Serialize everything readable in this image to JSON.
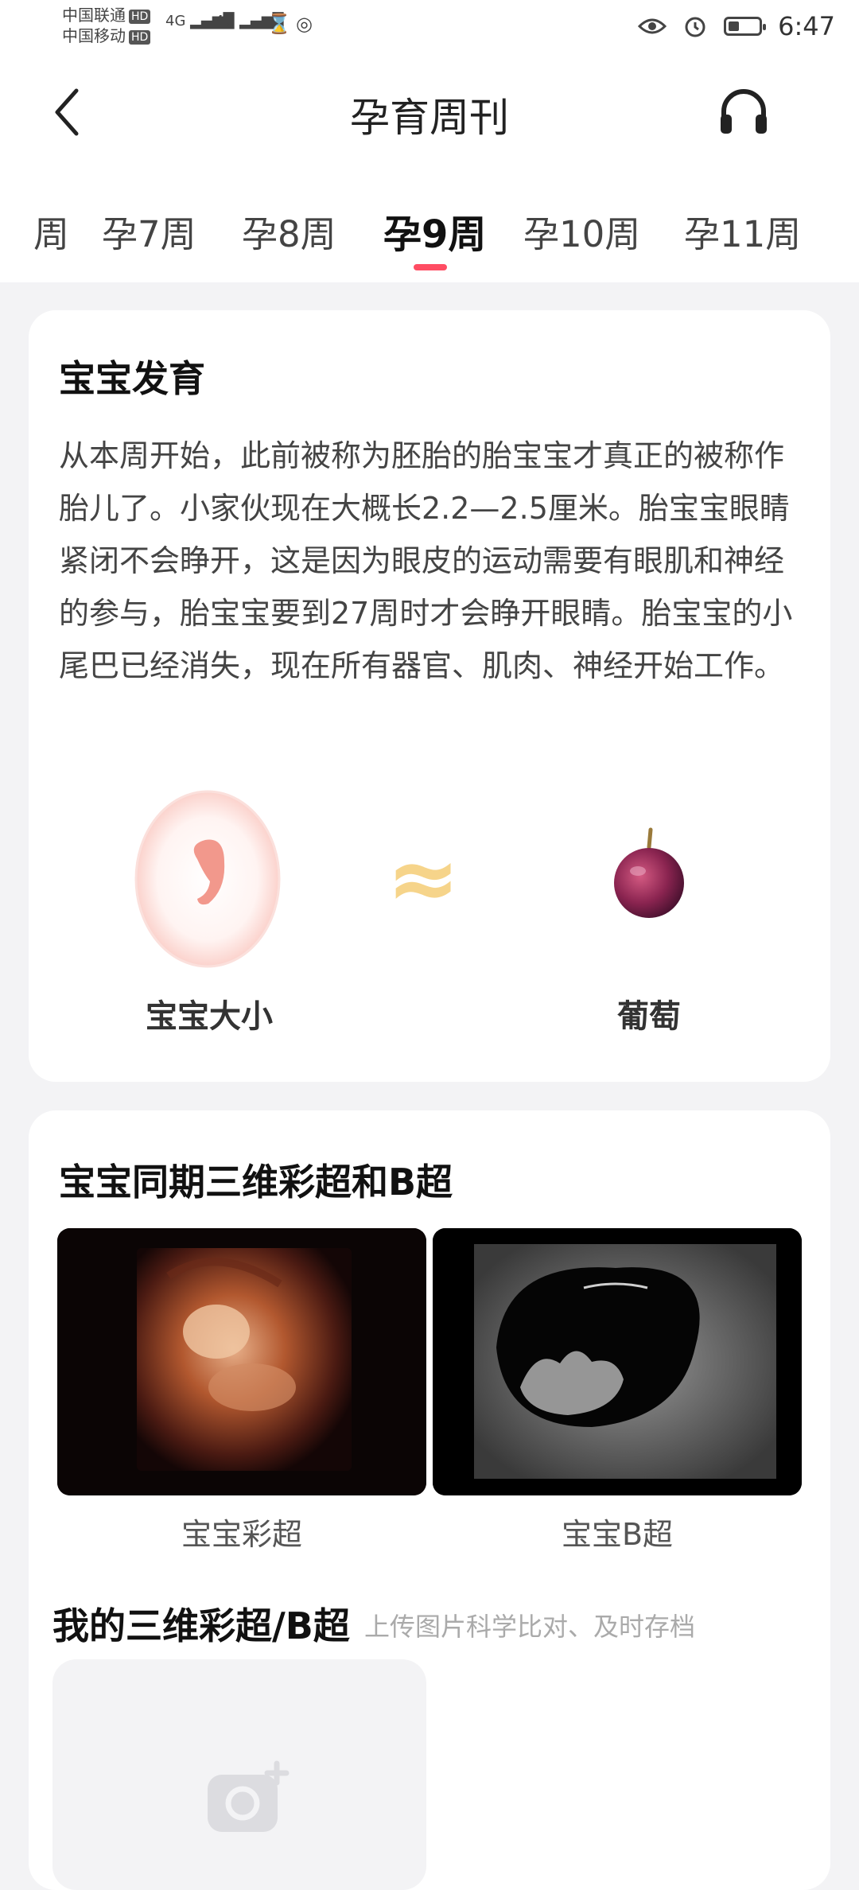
{
  "status_bar": {
    "carrier1": "中国联通",
    "carrier2": "中国移动",
    "hd_label": "HD",
    "network1": "4G",
    "network2": "4G",
    "time": "6:47",
    "icons": [
      "eye-icon",
      "alarm-icon",
      "battery-icon",
      "hourglass-icon",
      "nfc-icon"
    ]
  },
  "header": {
    "title": "孕育周刊"
  },
  "tabs": [
    {
      "label": "周"
    },
    {
      "label": "孕7周"
    },
    {
      "label": "孕8周"
    },
    {
      "label": "孕9周",
      "active": true
    },
    {
      "label": "孕10周"
    },
    {
      "label": "孕11周"
    }
  ],
  "development": {
    "title": "宝宝发育",
    "text": "从本周开始，此前被称为胚胎的胎宝宝才真正的被称作胎儿了。小家伙现在大概长2.2—2.5厘米。胎宝宝眼睛紧闭不会睁开，这是因为眼皮的运动需要有眼肌和神经的参与，胎宝宝要到27周时才会睁开眼睛。胎宝宝的小尾巴已经消失，现在所有器官、肌肉、神经开始工作。",
    "approx_symbol": "≈",
    "baby_size_label": "宝宝大小",
    "fruit_label": "葡萄"
  },
  "ultrasound": {
    "title": "宝宝同期三维彩超和B超",
    "color_caption": "宝宝彩超",
    "b_caption": "宝宝B超",
    "my_title": "我的三维彩超/B超",
    "my_subtitle": "上传图片科学比对、及时存档"
  },
  "colors": {
    "accent": "#ff4d63",
    "approx": "#f6d48a",
    "background": "#f3f3f5"
  }
}
